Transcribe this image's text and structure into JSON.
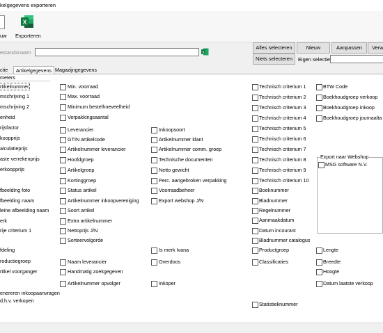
{
  "window": {
    "title": "kelgegevens exporteren"
  },
  "toolbar": {
    "new_label": "uw",
    "export_label": "Exporteren"
  },
  "filter": {
    "file_name_label": "estandsnaam",
    "file_name_value": "",
    "select_all": "Alles selecteren",
    "new": "Nieuw",
    "edit": "Aanpassen",
    "delete": "Verwij",
    "select_none": "Niets selecteren",
    "own_selection_label": "Eigen selectie",
    "own_selection_value": ""
  },
  "tabs": [
    "ctie",
    "Artikelgegevens",
    "Magazijngegevens"
  ],
  "params_label": "meters",
  "columns": {
    "col1": [
      "rtikelnummer",
      "mschrijving 1",
      "mschrijving 2",
      "enheid",
      "rijsfactor",
      "koopprijs",
      "alculatieprijs",
      "aste verrekenprijs",
      "erkoopprijs",
      "fbeelding foto",
      "fbeelding naam",
      "leine afbeelding naam",
      "erk",
      "rije criterium 1",
      "fdeling",
      "roductiegroep",
      "rtikel voorganger",
      "enereren inkoopaanvragen",
      "d.h.v. verkopen"
    ],
    "col2": [
      "Min. voorraad",
      "Max. voorraad",
      "Minimum bestelhoeveelheid",
      "Verpakkingsaantal",
      "Leverancier",
      "GTIN artikelcode",
      "Artikelnummer leverancier",
      "Hoofdgroep",
      "Artikelgroep",
      "Kortinggroep",
      "Status artikel",
      "Artikelnummer inkoopvereniging",
      "Soort artikel",
      "Extra artikelnummer",
      "Nettoprijs J/N",
      "Sorteervolgorde",
      "Naam leverancier",
      "Handmatig zoekgegeven",
      "Artikelnummer opvolger"
    ],
    "col3": [
      "Inkoopsoort",
      "Artikelnummer klant",
      "Artikelnummer comm. groep",
      "Technische documenten",
      "Netto gewicht",
      "Perc. aangebroken verpakking",
      "Voorraadbeheer",
      "Export webshop J/N",
      "Is merk Ivana",
      "Overdoos",
      "Inkoper"
    ],
    "col4": [
      "Technisch criterium 1",
      "Technisch criterium 2",
      "Technisch criterium 3",
      "Technisch criterium 4",
      "Technisch criterium 5",
      "Technisch criterium 6",
      "Technisch criterium 7",
      "Technisch criterium 8",
      "Technisch criterium 9",
      "Technisch criterium 10",
      "Boeknummer",
      "Bladnummer",
      "Regelnummer",
      "Aanmaakdatum",
      "Datum incourant",
      "Bladnummer catalogus",
      "Productgroep",
      "Classificaties",
      "Statistieknummer"
    ],
    "col5": [
      "BTW Code",
      "Boekhoudgroep verkoop",
      "Boekhoudgroep inkoop",
      "Boekhoudgroep journaalta",
      "Lengte",
      "Breedte",
      "Hoogte",
      "Datum laatste verkoop"
    ]
  },
  "webshop": {
    "title": "Export naar Webshop",
    "items": [
      "MSG software N.V."
    ]
  }
}
